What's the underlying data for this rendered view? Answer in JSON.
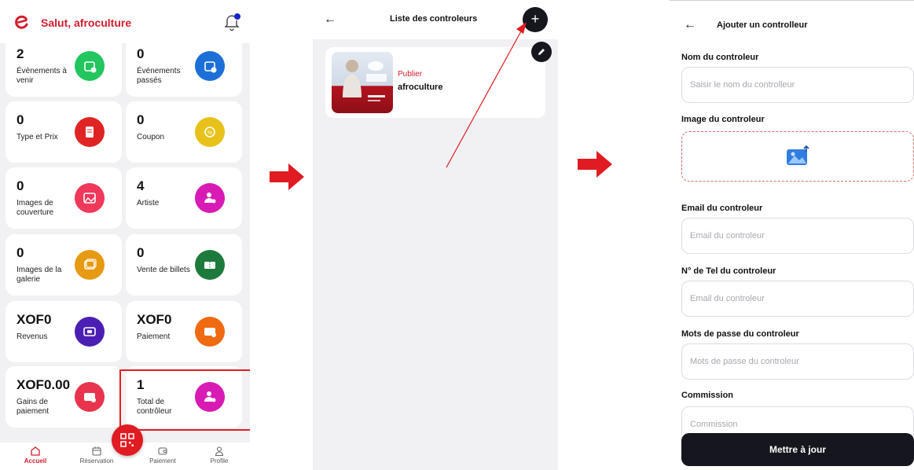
{
  "dashboard": {
    "greeting": "Salut, afroculture",
    "cards": [
      {
        "value": "2",
        "label": "Évènements à venir",
        "color": "#22c55e",
        "icon": "calendar-clock-icon"
      },
      {
        "value": "0",
        "label": "Événements passés",
        "color": "#1d6fd8",
        "icon": "calendar-check-icon"
      },
      {
        "value": "0",
        "label": "Type et Prix",
        "color": "#e02424",
        "icon": "receipt-icon"
      },
      {
        "value": "0",
        "label": "Coupon",
        "color": "#e8c21a",
        "icon": "coupon-icon"
      },
      {
        "value": "0",
        "label": "Images de couverture",
        "color": "#f0385a",
        "icon": "image-icon"
      },
      {
        "value": "4",
        "label": "Artiste",
        "color": "#d81bb4",
        "icon": "artist-icon"
      },
      {
        "value": "0",
        "label": "Images de la galerie",
        "color": "#e69a12",
        "icon": "gallery-icon"
      },
      {
        "value": "0",
        "label": "Vente de billets",
        "color": "#1e7a3c",
        "icon": "ticket-icon"
      },
      {
        "value": "XOF0",
        "label": "Revenus",
        "color": "#4b1fb4",
        "icon": "wallet-icon"
      },
      {
        "value": "XOF0",
        "label": "Paiement",
        "color": "#f06a12",
        "icon": "payment-icon"
      },
      {
        "value": "XOF0.00",
        "label": "Gains de paiement",
        "color": "#e8344e",
        "icon": "earnings-icon"
      },
      {
        "value": "1",
        "label": "Total de contrôleur",
        "color": "#d81bb4",
        "icon": "controller-icon"
      }
    ],
    "nav": [
      {
        "label": "Accueil",
        "icon": "home-icon",
        "active": true
      },
      {
        "label": "Réservation",
        "icon": "calendar-icon",
        "active": false
      },
      {
        "label": "Paiement",
        "icon": "wallet-icon",
        "active": false
      },
      {
        "label": "Profile",
        "icon": "user-icon",
        "active": false
      }
    ]
  },
  "list": {
    "title": "Liste des controleurs",
    "items": [
      {
        "status": "Publier",
        "name": "afroculture"
      }
    ]
  },
  "form": {
    "title": "Ajouter un controlleur",
    "name_label": "Nom du controleur",
    "name_placeholder": "Saisir le nom du controlleur",
    "image_label": "Image du controleur",
    "email_label": "Email du controleur",
    "email_placeholder": "Email du controleur",
    "phone_label": "N° de Tel du controleur",
    "phone_placeholder": "Email du controleur",
    "password_label": "Mots de passe du controleur",
    "password_placeholder": "Mots de passe du controleur",
    "commission_label": "Commission",
    "commission_placeholder": "Commission",
    "submit_label": "Mettre à jour"
  },
  "colors": {
    "brand_red": "#d31d2c",
    "dark_button": "#16161e",
    "annotation_red": "#e01b22"
  }
}
